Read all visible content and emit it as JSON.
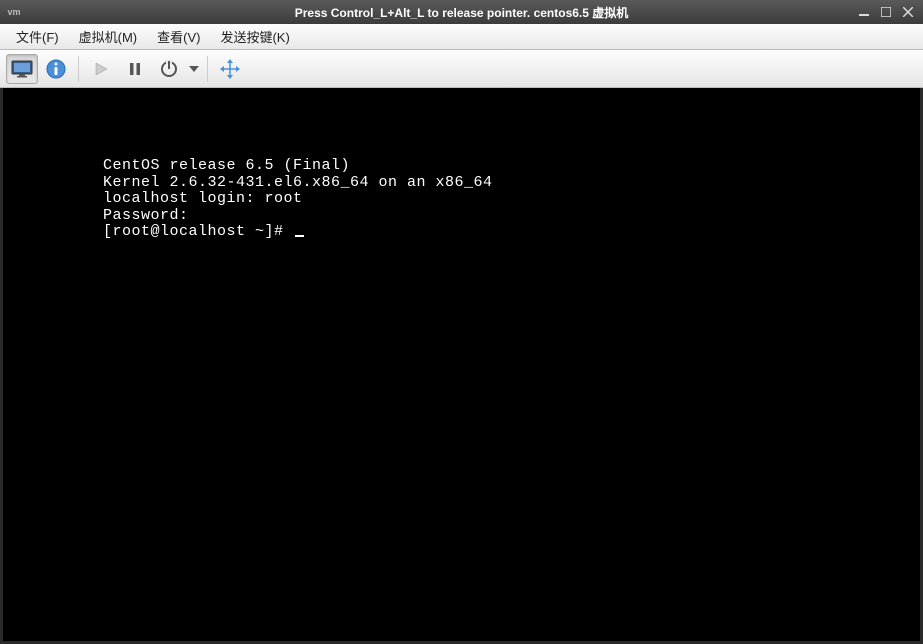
{
  "titlebar": {
    "logo": "vm",
    "text": "Press Control_L+Alt_L to release pointer. centos6.5 虚拟机"
  },
  "menubar": {
    "file": "文件(F)",
    "vm": "虚拟机(M)",
    "view": "查看(V)",
    "sendkey": "发送按键(K)"
  },
  "terminal": {
    "line1": "CentOS release 6.5 (Final)",
    "line2": "Kernel 2.6.32-431.el6.x86_64 on an x86_64",
    "blank": "",
    "login_line": "localhost login: root",
    "password_line": "Password: ",
    "prompt": "[root@localhost ~]# "
  }
}
